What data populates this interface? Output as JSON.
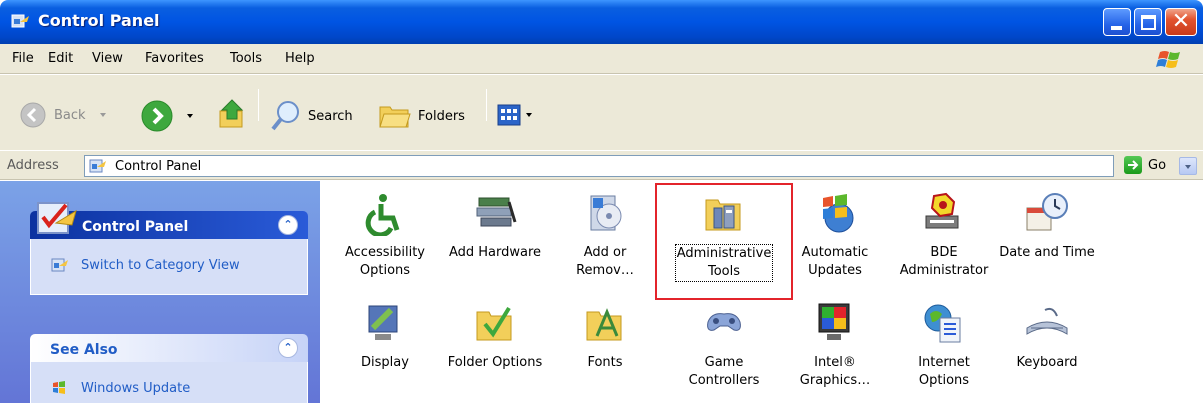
{
  "window": {
    "title": "Control Panel",
    "close_glyph": "✕"
  },
  "menu": [
    "File",
    "Edit",
    "View",
    "Favorites",
    "Tools",
    "Help"
  ],
  "toolbar": {
    "back_label": "Back",
    "search_label": "Search",
    "folders_label": "Folders"
  },
  "address": {
    "label": "Address",
    "value": "Control Panel",
    "go_label": "Go"
  },
  "taskpane": {
    "control_panel": {
      "title": "Control Panel",
      "collapse_glyph": "⌃",
      "link": "Switch to Category View"
    },
    "see_also": {
      "title": "See Also",
      "collapse_glyph": "⌃",
      "link": "Windows Update"
    }
  },
  "icons_row1": [
    {
      "name": "accessibility-options",
      "line1": "Accessibility",
      "line2": "Options",
      "icon": "wheelchair-icon"
    },
    {
      "name": "add-hardware",
      "line1": "Add Hardware",
      "line2": "",
      "icon": "hardware-icon"
    },
    {
      "name": "add-or-remove",
      "line1": "Add or",
      "line2": "Remov…",
      "icon": "add-remove-icon"
    },
    {
      "name": "administrative-tools",
      "line1": "Administrative",
      "line2": "Tools",
      "icon": "admin-tools-icon"
    },
    {
      "name": "automatic-updates",
      "line1": "Automatic",
      "line2": "Updates",
      "icon": "windows-globe-icon"
    },
    {
      "name": "bde-administrator",
      "line1": "BDE",
      "line2": "Administrator",
      "icon": "bde-icon"
    },
    {
      "name": "date-and-time",
      "line1": "Date and Time",
      "line2": "",
      "icon": "clock-calendar-icon"
    }
  ],
  "icons_row2": [
    {
      "name": "display",
      "line1": "Display",
      "line2": "",
      "icon": "display-icon"
    },
    {
      "name": "folder-options",
      "line1": "Folder Options",
      "line2": "",
      "icon": "folder-check-icon"
    },
    {
      "name": "fonts",
      "line1": "Fonts",
      "line2": "",
      "icon": "fonts-folder-icon"
    },
    {
      "name": "game-controllers",
      "line1": "Game",
      "line2": "Controllers",
      "icon": "gamepad-icon"
    },
    {
      "name": "intel-graphics",
      "line1": "Intel®",
      "line2": "Graphics…",
      "icon": "intel-monitor-icon"
    },
    {
      "name": "internet-options",
      "line1": "Internet",
      "line2": "Options",
      "icon": "globe-document-icon"
    },
    {
      "name": "keyboard",
      "line1": "Keyboard",
      "line2": "",
      "icon": "keyboard-icon"
    }
  ],
  "colors": {
    "titlebar": "#0054e3",
    "taskpane": "#7ba2e7",
    "selection": "#e3242b",
    "link": "#215dc6"
  }
}
